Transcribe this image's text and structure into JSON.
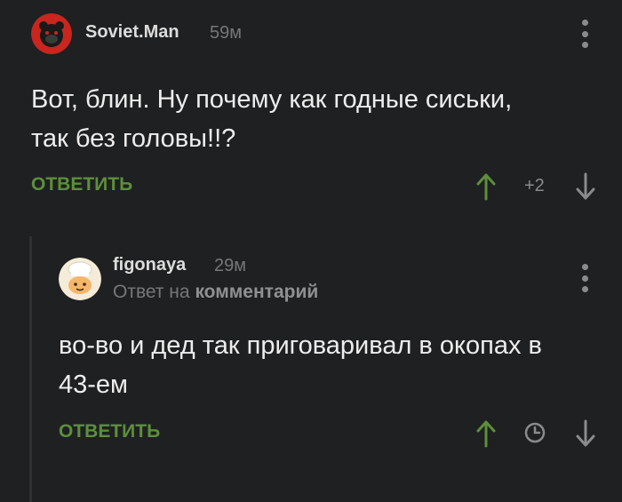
{
  "comment": {
    "author": "Soviet.Man",
    "time": "59м",
    "text_line1": "Вот, блин. Ну почему как годные сиськи,",
    "text_line2": "так без головы!!?",
    "reply_label": "ОТВЕТИТЬ",
    "rating": "+2"
  },
  "reply": {
    "author": "figonaya",
    "time": "29м",
    "reply_to_prefix": "Ответ на",
    "reply_to_link": "комментарий",
    "text_line1": "во-во и дед так приговаривал в окопах в",
    "text_line2": "43-ем",
    "reply_label": "ОТВЕТИТЬ"
  },
  "colors": {
    "background": "#1f2022",
    "accent_green": "#5c8f3b",
    "muted_text": "#767778"
  },
  "icons": {
    "upvote": "arrow-up-icon",
    "downvote": "arrow-down-icon",
    "menu": "more-vertical-icon",
    "pending": "clock-icon"
  }
}
